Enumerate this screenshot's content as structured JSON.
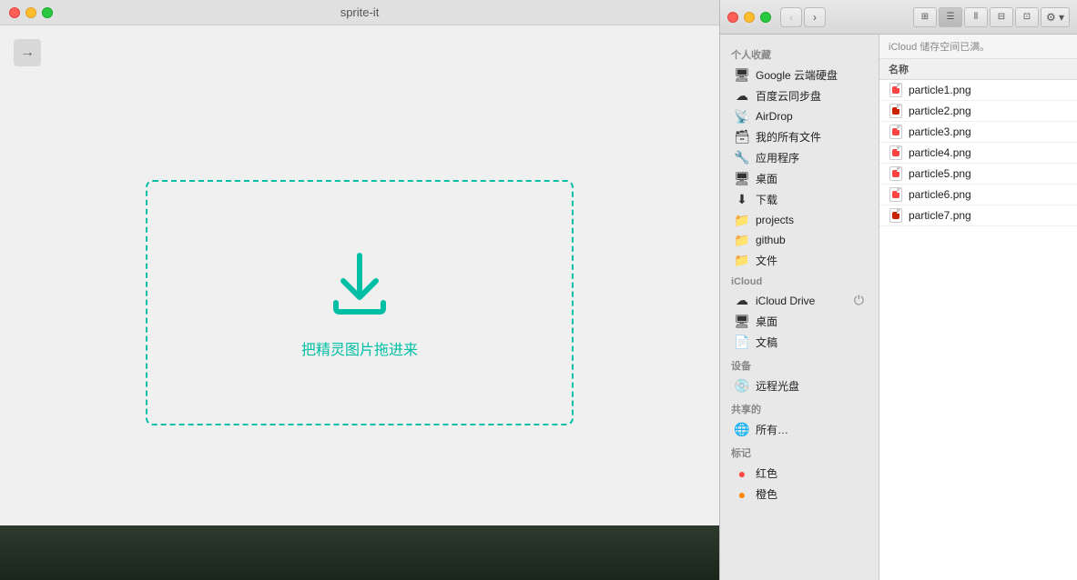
{
  "app": {
    "title": "sprite-it",
    "back_button_label": "→",
    "drop_text": "把精灵图片拖进来"
  },
  "finder": {
    "status_bar_text": "iCloud 储存空间已满。",
    "column_header": "名称",
    "icloud_section_label": "iCloud",
    "nav_back_label": "‹",
    "nav_forward_label": "›",
    "sidebar": {
      "personal_section": "个人收藏",
      "items": [
        {
          "id": "google-drive",
          "label": "Google 云端硬盘",
          "icon": "🖥"
        },
        {
          "id": "baidu-sync",
          "label": "百度云同步盘",
          "icon": "☁"
        },
        {
          "id": "airdrop",
          "label": "AirDrop",
          "icon": "📡"
        },
        {
          "id": "all-files",
          "label": "我的所有文件",
          "icon": "🗃"
        },
        {
          "id": "applications",
          "label": "应用程序",
          "icon": "🔧"
        },
        {
          "id": "desktop",
          "label": "桌面",
          "icon": "🖥"
        },
        {
          "id": "downloads",
          "label": "下载",
          "icon": "⬇"
        },
        {
          "id": "projects",
          "label": "projects",
          "icon": "📁"
        },
        {
          "id": "github",
          "label": "github",
          "icon": "📁"
        },
        {
          "id": "documents",
          "label": "文件",
          "icon": "📁"
        }
      ],
      "icloud_section": "iCloud",
      "icloud_items": [
        {
          "id": "icloud-drive",
          "label": "iCloud Drive",
          "icon": "☁"
        },
        {
          "id": "icloud-desktop",
          "label": "桌面",
          "icon": "🖥"
        },
        {
          "id": "icloud-documents",
          "label": "文稿",
          "icon": "📄"
        }
      ],
      "devices_section": "设备",
      "devices_items": [
        {
          "id": "remote-disc",
          "label": "远程光盘",
          "icon": "💿"
        }
      ],
      "shared_section": "共享的",
      "shared_items": [
        {
          "id": "all-shared",
          "label": "所有…",
          "icon": "🌐"
        }
      ],
      "tags_section": "标记",
      "tags_items": [
        {
          "id": "tag-red",
          "label": "红色",
          "color": "#ff4444"
        },
        {
          "id": "tag-orange",
          "label": "橙色",
          "color": "#ff8800"
        }
      ]
    },
    "files": [
      {
        "name": "particle1.png",
        "icon_color": "#ff4444"
      },
      {
        "name": "particle2.png",
        "icon_color": "#cc2200"
      },
      {
        "name": "particle3.png",
        "icon_color": "#ff4444"
      },
      {
        "name": "particle4.png",
        "icon_color": "#ff4444"
      },
      {
        "name": "particle5.png",
        "icon_color": "#ff4444"
      },
      {
        "name": "particle6.png",
        "icon_color": "#ff4444"
      },
      {
        "name": "particle7.png",
        "icon_color": "#cc2200"
      }
    ]
  },
  "colors": {
    "teal": "#00bfa5",
    "traffic_close": "#ff5f57",
    "traffic_minimize": "#ffbd2e",
    "traffic_maximize": "#28c940"
  }
}
